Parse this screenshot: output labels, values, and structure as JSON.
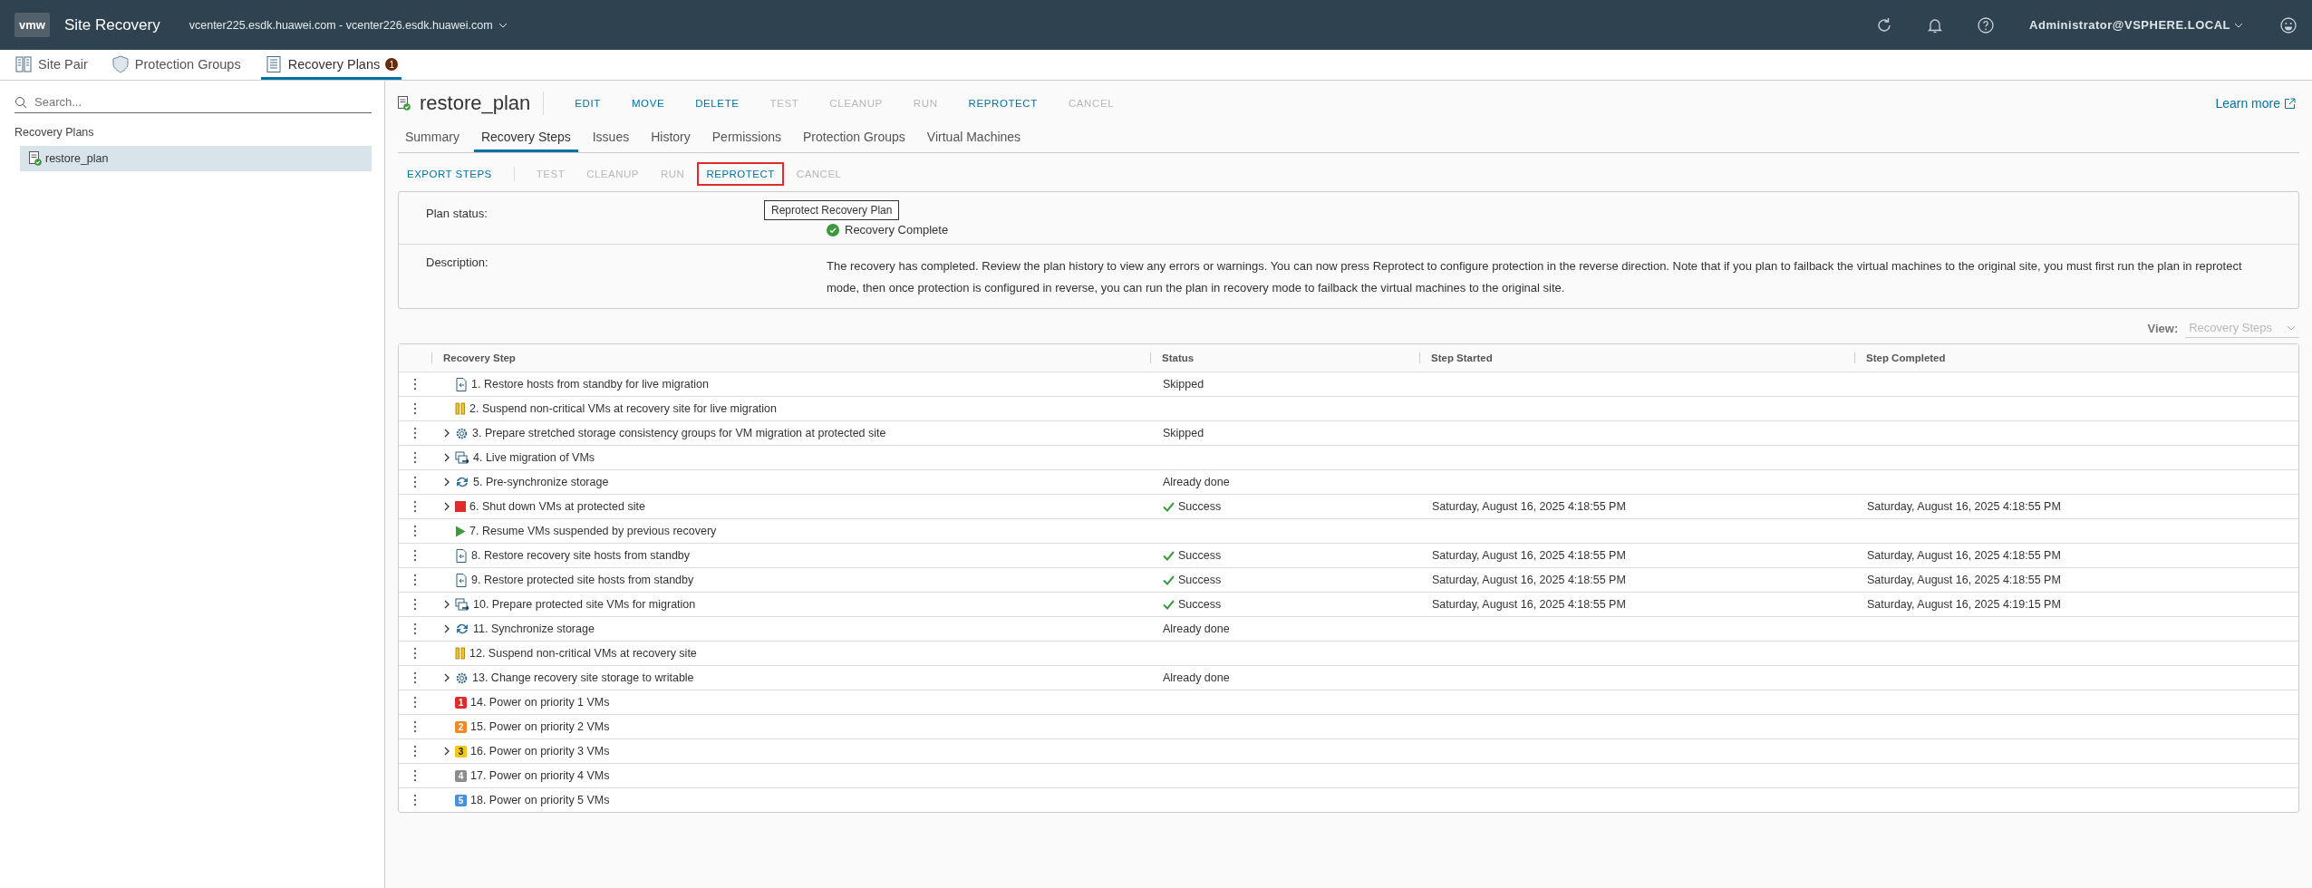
{
  "header": {
    "logo": "vmw",
    "title": "Site Recovery",
    "site_pair": "vcenter225.esdk.huawei.com - vcenter226.esdk.huawei.com",
    "user": "Administrator@VSPHERE.LOCAL"
  },
  "tabs": [
    {
      "label": "Site Pair",
      "kind": "pair",
      "selected": false
    },
    {
      "label": "Protection Groups",
      "kind": "shield",
      "selected": false
    },
    {
      "label": "Recovery Plans",
      "kind": "plan",
      "selected": true,
      "badge": "1"
    }
  ],
  "sidebar": {
    "search": {
      "placeholder": "Search..."
    },
    "section": "Recovery Plans",
    "items": [
      {
        "label": "restore_plan",
        "selected": true
      }
    ]
  },
  "plan": {
    "name": "restore_plan",
    "learn_more": "Learn more",
    "actions": [
      {
        "label": "EDIT",
        "disabled": false
      },
      {
        "label": "MOVE",
        "disabled": false
      },
      {
        "label": "DELETE",
        "disabled": false
      },
      {
        "label": "TEST",
        "disabled": true
      },
      {
        "label": "CLEANUP",
        "disabled": true
      },
      {
        "label": "RUN",
        "disabled": true
      },
      {
        "label": "REPROTECT",
        "disabled": false
      },
      {
        "label": "CANCEL",
        "disabled": true
      }
    ],
    "subtabs": [
      {
        "label": "Summary",
        "selected": false
      },
      {
        "label": "Recovery Steps",
        "selected": true
      },
      {
        "label": "Issues",
        "selected": false
      },
      {
        "label": "History",
        "selected": false
      },
      {
        "label": "Permissions",
        "selected": false
      },
      {
        "label": "Protection Groups",
        "selected": false
      },
      {
        "label": "Virtual Machines",
        "selected": false
      }
    ]
  },
  "steps_toolbar": [
    {
      "label": "EXPORT STEPS",
      "disabled": false,
      "highlighted": false
    },
    {
      "label": "TEST",
      "disabled": true,
      "highlighted": false
    },
    {
      "label": "CLEANUP",
      "disabled": true,
      "highlighted": false
    },
    {
      "label": "RUN",
      "disabled": true,
      "highlighted": false
    },
    {
      "label": "REPROTECT",
      "disabled": false,
      "highlighted": true
    },
    {
      "label": "CANCEL",
      "disabled": true,
      "highlighted": false
    }
  ],
  "tooltip": "Reprotect Recovery Plan",
  "details": {
    "status_label": "Plan status:",
    "status": "Recovery Complete",
    "description_label": "Description:",
    "description": "The recovery has completed. Review the plan history to view any errors or warnings. You can now press Reprotect to configure protection in the reverse direction. Note that if you plan to failback the virtual machines to the original site, you must first run the plan in reprotect mode, then once protection is configured in reverse, you can run the plan in recovery mode to failback the virtual machines to the original site."
  },
  "view": {
    "label": "View:",
    "value": "Recovery Steps",
    "disabled": true
  },
  "table": {
    "columns": [
      "Recovery Step",
      "Status",
      "Step Started",
      "Step Completed"
    ],
    "rows": [
      {
        "step": "1. Restore hosts from standby for live migration",
        "kind": "host",
        "expandable": false,
        "status": "Skipped",
        "succeeded": false
      },
      {
        "step": "2. Suspend non-critical VMs at recovery site for live migration",
        "kind": "pause",
        "expandable": false
      },
      {
        "step": "3. Prepare stretched storage consistency groups for VM migration at protected site",
        "kind": "gear",
        "expandable": true,
        "status": "Skipped",
        "succeeded": false
      },
      {
        "step": "4. Live migration of VMs",
        "kind": "migrate",
        "expandable": true
      },
      {
        "step": "5. Pre-synchronize storage",
        "kind": "sync",
        "expandable": true,
        "status": "Already done",
        "succeeded": false
      },
      {
        "step": "6. Shut down VMs at protected site",
        "kind": "stop",
        "expandable": true,
        "status": "Success",
        "succeeded": true,
        "started": "Saturday, August 16, 2025 4:18:55 PM",
        "completed": "Saturday, August 16, 2025 4:18:55 PM"
      },
      {
        "step": "7. Resume VMs suspended by previous recovery",
        "kind": "play",
        "expandable": false
      },
      {
        "step": "8. Restore recovery site hosts from standby",
        "kind": "host",
        "expandable": false,
        "status": "Success",
        "succeeded": true,
        "started": "Saturday, August 16, 2025 4:18:55 PM",
        "completed": "Saturday, August 16, 2025 4:18:55 PM"
      },
      {
        "step": "9. Restore protected site hosts from standby",
        "kind": "host",
        "expandable": false,
        "status": "Success",
        "succeeded": true,
        "started": "Saturday, August 16, 2025 4:18:55 PM",
        "completed": "Saturday, August 16, 2025 4:18:55 PM"
      },
      {
        "step": "10. Prepare protected site VMs for migration",
        "kind": "migrate",
        "expandable": true,
        "status": "Success",
        "succeeded": true,
        "started": "Saturday, August 16, 2025 4:18:55 PM",
        "completed": "Saturday, August 16, 2025 4:19:15 PM"
      },
      {
        "step": "11. Synchronize storage",
        "kind": "sync",
        "expandable": true,
        "status": "Already done",
        "succeeded": false
      },
      {
        "step": "12. Suspend non-critical VMs at recovery site",
        "kind": "pause",
        "expandable": false
      },
      {
        "step": "13. Change recovery site storage to writable",
        "kind": "gear",
        "expandable": true,
        "status": "Already done",
        "succeeded": false
      },
      {
        "step": "14. Power on priority 1 VMs",
        "kind": "priority",
        "badge": "1",
        "color": "#e12a2a",
        "expandable": false
      },
      {
        "step": "15. Power on priority 2 VMs",
        "kind": "priority",
        "badge": "2",
        "color": "#f08a24",
        "expandable": false
      },
      {
        "step": "16. Power on priority 3 VMs",
        "kind": "priority",
        "badge": "3",
        "color": "#f5c518",
        "expandable": true
      },
      {
        "step": "17. Power on priority 4 VMs",
        "kind": "priority",
        "badge": "4",
        "color": "#8c8c8c",
        "expandable": false
      },
      {
        "step": "18. Power on priority 5 VMs",
        "kind": "priority",
        "badge": "5",
        "color": "#4a90d9",
        "expandable": false
      }
    ]
  }
}
